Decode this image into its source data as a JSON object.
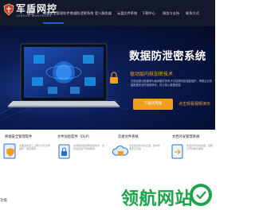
{
  "header": {
    "logo_text": "军盾网控",
    "logo_sub": "JUNDUN WANGKONG",
    "nav": [
      "首页",
      "终端安全管理软件",
      "数据防泄密系统",
      "登入服务器",
      "云盘文件系统",
      "下载中心",
      "服务与支持",
      "联系方式"
    ]
  },
  "hero": {
    "title": "数据防泄密系统",
    "subtitle": "驱动层内核加密技术",
    "description": "文档加密功能能够为各种格式的电子文档提供高强度保护，帮助企业构建数据安全防泄密体系，防止核心数据泄露",
    "trial_button": "下载试用版",
    "online_link": "点击观看视频演示"
  },
  "products": [
    {
      "title": "终端安全管理软件",
      "desc": "全面监控员工上网行为及文件操作，规范使用"
    },
    {
      "title": "文件加密软件（DLP）",
      "desc": "采用驱动层透明加密技术，文件加密后不影响使用"
    },
    {
      "title": "云盘文件系统",
      "desc": "企业级文件共享云盘，集中存储安全可控"
    },
    {
      "title": "文档外发管理系统",
      "desc": "外发文件自动加密，控制打开次数与期限"
    }
  ],
  "bottom_label": "功能",
  "watermark": "领航网站",
  "colors": {
    "nav_bg": "#13182b",
    "accent_orange": "#f0a020",
    "subtitle_gold": "#f5a623",
    "watermark_green": "#1fa34a"
  }
}
